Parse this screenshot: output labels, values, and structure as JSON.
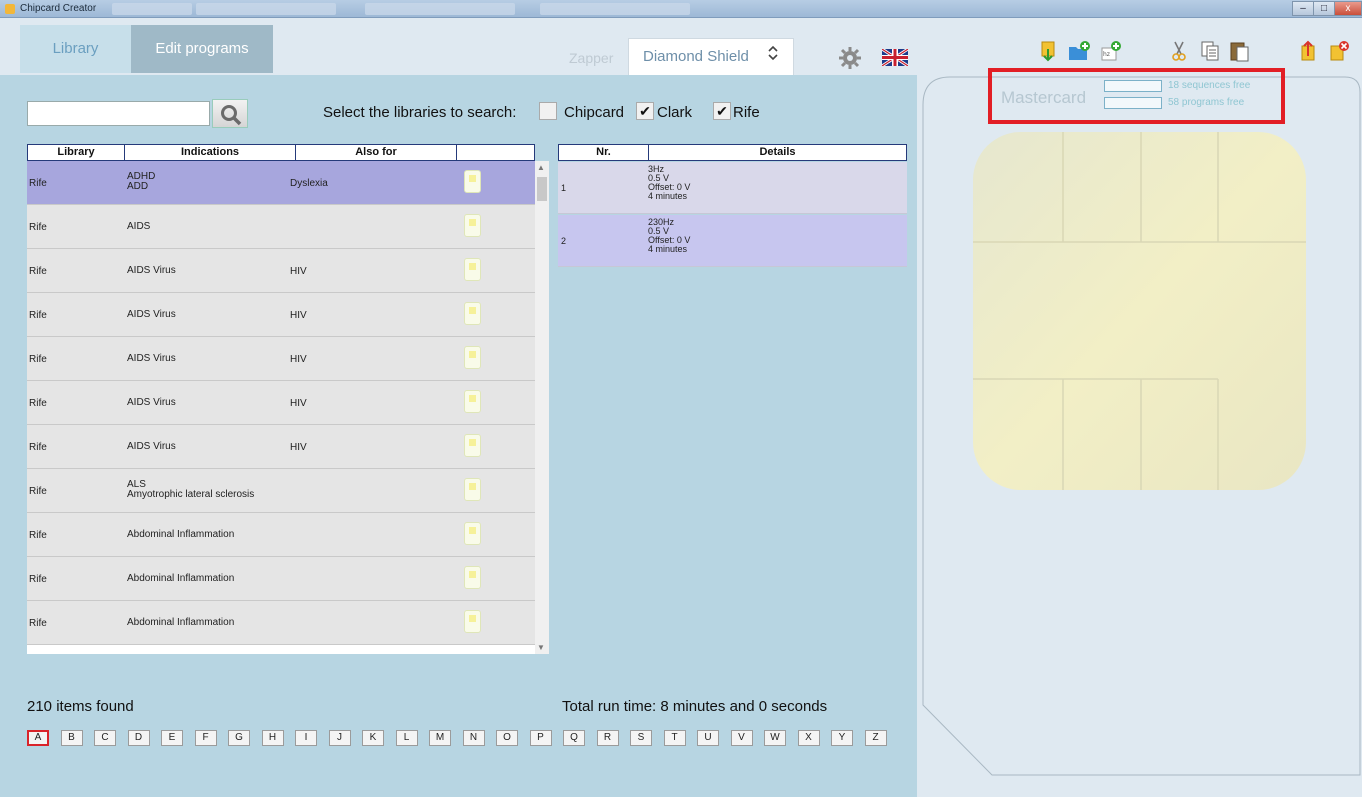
{
  "window": {
    "title": "Chipcard Creator",
    "minimize_label": "–",
    "maximize_label": "□",
    "close_label": "x"
  },
  "tabs": {
    "library": "Library",
    "edit_programs": "Edit programs"
  },
  "zapper": {
    "label": "Zapper",
    "value": "Diamond Shield",
    "chevron": "⌄⌃"
  },
  "search": {
    "value": "",
    "placeholder": "",
    "select_label": "Select the libraries to search:",
    "libraries": [
      {
        "label": "Chipcard",
        "checked": false,
        "mark": ""
      },
      {
        "label": "Clark",
        "checked": true,
        "mark": "✔"
      },
      {
        "label": "Rife",
        "checked": true,
        "mark": "✔"
      }
    ]
  },
  "library_table": {
    "headers": [
      "Library",
      "Indications",
      "Also for",
      ""
    ],
    "rows": [
      {
        "library": "Rife",
        "indications": [
          "ADHD",
          "ADD"
        ],
        "also": "Dyslexia",
        "selected": true
      },
      {
        "library": "Rife",
        "indications": [
          "AIDS"
        ],
        "also": "",
        "selected": false
      },
      {
        "library": "Rife",
        "indications": [
          "AIDS Virus"
        ],
        "also": "HIV",
        "selected": false
      },
      {
        "library": "Rife",
        "indications": [
          "AIDS Virus"
        ],
        "also": "HIV",
        "selected": false
      },
      {
        "library": "Rife",
        "indications": [
          "AIDS Virus"
        ],
        "also": "HIV",
        "selected": false
      },
      {
        "library": "Rife",
        "indications": [
          "AIDS Virus"
        ],
        "also": "HIV",
        "selected": false
      },
      {
        "library": "Rife",
        "indications": [
          "AIDS Virus"
        ],
        "also": "HIV",
        "selected": false
      },
      {
        "library": "Rife",
        "indications": [
          "ALS",
          "Amyotrophic lateral sclerosis"
        ],
        "also": "",
        "selected": false
      },
      {
        "library": "Rife",
        "indications": [
          "Abdominal Inflammation"
        ],
        "also": "",
        "selected": false
      },
      {
        "library": "Rife",
        "indications": [
          "Abdominal Inflammation"
        ],
        "also": "",
        "selected": false
      },
      {
        "library": "Rife",
        "indications": [
          "Abdominal Inflammation"
        ],
        "also": "",
        "selected": false
      }
    ]
  },
  "details_table": {
    "headers": [
      "Nr.",
      "Details"
    ],
    "rows": [
      {
        "nr": "1",
        "lines": [
          "3Hz",
          "0.5 V",
          "Offset: 0 V",
          "4 minutes"
        ]
      },
      {
        "nr": "2",
        "lines": [
          "230Hz",
          "0.5 V",
          "Offset: 0 V",
          "4 minutes"
        ]
      }
    ]
  },
  "items_found": "210 items found",
  "total_runtime": "Total run time: 8 minutes and 0 seconds",
  "alphabet": [
    "A",
    "B",
    "C",
    "D",
    "E",
    "F",
    "G",
    "H",
    "I",
    "J",
    "K",
    "L",
    "M",
    "N",
    "O",
    "P",
    "Q",
    "R",
    "S",
    "T",
    "U",
    "V",
    "W",
    "X",
    "Y",
    "Z"
  ],
  "alphabet_active": "A",
  "card": {
    "label": "Mastercard",
    "sequences_free": "18 sequences free",
    "programs_free": "58 programs free"
  },
  "icons": {
    "settings": "gear-icon",
    "language": "uk-flag-icon",
    "toolbar": [
      "download-card-icon",
      "new-folder-icon",
      "new-program-icon",
      "cut-icon",
      "copy-icon",
      "paste-icon",
      "upload-card-icon",
      "delete-card-icon"
    ]
  },
  "colors": {
    "accent": "#b7d5e2",
    "selected_row": "#a7a6dd",
    "highlight": "#e21e25"
  }
}
